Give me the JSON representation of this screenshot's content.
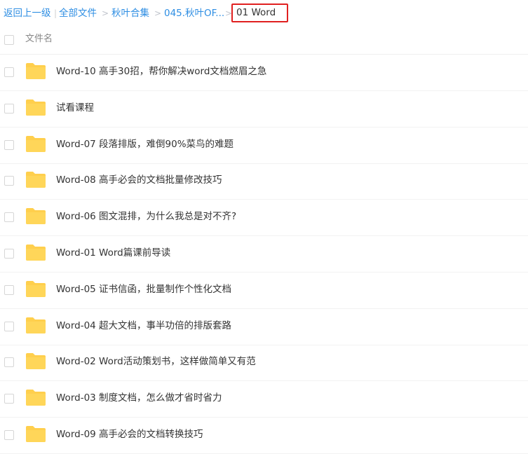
{
  "breadcrumb": {
    "back": "返回上一级",
    "divider": "|",
    "items": [
      "全部文件",
      "秋叶合集",
      "045.秋叶OF..."
    ],
    "separator": ">",
    "current": "01 Word"
  },
  "header": {
    "filename_label": "文件名"
  },
  "files": [
    {
      "name": "Word-10 高手30招，帮你解决word文档燃眉之急",
      "icon": "folder-icon"
    },
    {
      "name": "试看课程",
      "icon": "folder-icon"
    },
    {
      "name": "Word-07 段落排版，难倒90%菜鸟的难题",
      "icon": "folder-icon"
    },
    {
      "name": "Word-08 高手必会的文档批量修改技巧",
      "icon": "folder-icon"
    },
    {
      "name": "Word-06 图文混排，为什么我总是对不齐?",
      "icon": "folder-icon"
    },
    {
      "name": "Word-01 Word篇课前导读",
      "icon": "folder-icon"
    },
    {
      "name": "Word-05 证书信函，批量制作个性化文档",
      "icon": "folder-icon"
    },
    {
      "name": "Word-04 超大文档，事半功倍的排版套路",
      "icon": "folder-icon"
    },
    {
      "name": "Word-02 Word活动策划书，这样做简单又有范",
      "icon": "folder-icon"
    },
    {
      "name": "Word-03 制度文档，怎么做才省时省力",
      "icon": "folder-icon"
    },
    {
      "name": "Word-09 高手必会的文档转换技巧",
      "icon": "folder-icon"
    }
  ],
  "colors": {
    "link": "#2e8ee3",
    "folder": "#ffd659",
    "highlight": "#e02020"
  }
}
